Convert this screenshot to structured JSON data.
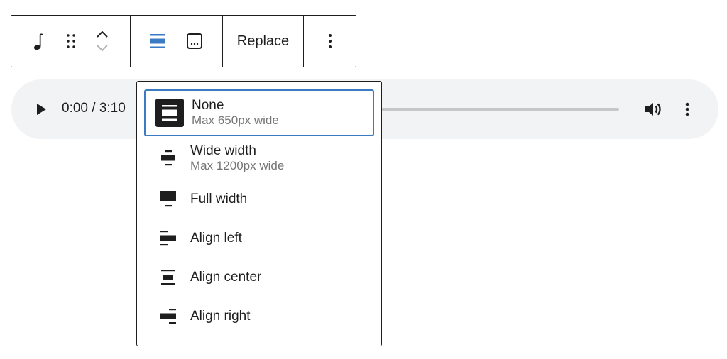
{
  "toolbar": {
    "block_type_icon": "music-note-icon",
    "drag_icon": "drag-handle-icon",
    "move_icon": "move-up-down-icon",
    "align_icon": "align-none-icon",
    "caption_icon": "caption-icon",
    "replace_label": "Replace",
    "more_icon": "more-vertical-icon"
  },
  "player": {
    "play_icon": "play-icon",
    "time": "0:00 / 3:10",
    "progress": 0,
    "volume_icon": "volume-icon",
    "more_icon": "more-vertical-icon"
  },
  "alignment_menu": {
    "selected": "none",
    "options": [
      {
        "id": "none",
        "label": "None",
        "description": "Max 650px wide",
        "icon": "align-none-icon"
      },
      {
        "id": "wide",
        "label": "Wide width",
        "description": "Max 1200px wide",
        "icon": "align-wide-icon"
      },
      {
        "id": "full",
        "label": "Full width",
        "description": "",
        "icon": "align-full-width-icon"
      },
      {
        "id": "left",
        "label": "Align left",
        "description": "",
        "icon": "align-left-icon"
      },
      {
        "id": "center",
        "label": "Align center",
        "description": "",
        "icon": "align-center-icon"
      },
      {
        "id": "right",
        "label": "Align right",
        "description": "",
        "icon": "align-right-icon"
      }
    ]
  },
  "colors": {
    "accent": "#3b7bc4",
    "text": "#1e1e1e",
    "muted": "#757575",
    "player_bg": "#f1f3f4"
  }
}
